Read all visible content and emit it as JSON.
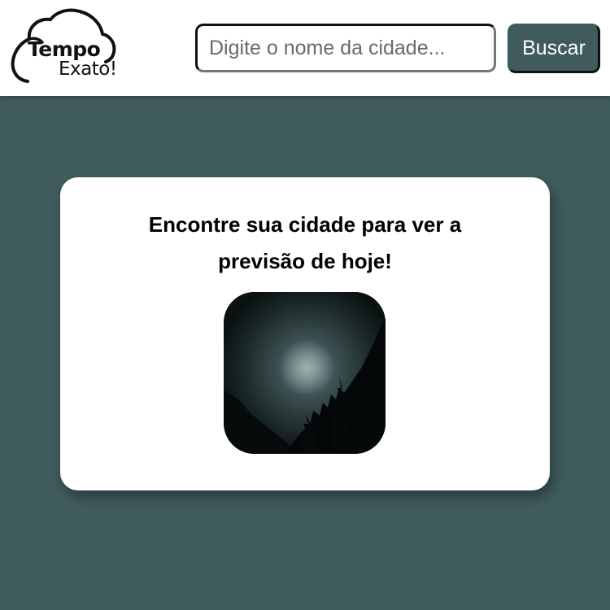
{
  "header": {
    "logo": {
      "line1": "Tempo",
      "line2": "Exato!",
      "icon": "cloud-icon"
    },
    "search": {
      "placeholder": "Digite o nome da cidade...",
      "value": ""
    },
    "search_button_label": "Buscar"
  },
  "main": {
    "card": {
      "title": "Encontre sua cidade para ver a previsão de hoje!",
      "image": {
        "icon": "moon-night-image",
        "description_kind": "crescent-moon-forest-night"
      }
    }
  },
  "colors": {
    "background": "#3f5b5c",
    "header": "#ffffff",
    "card": "#ffffff",
    "button": "#3f5b5c",
    "button_text": "#ffffff"
  }
}
